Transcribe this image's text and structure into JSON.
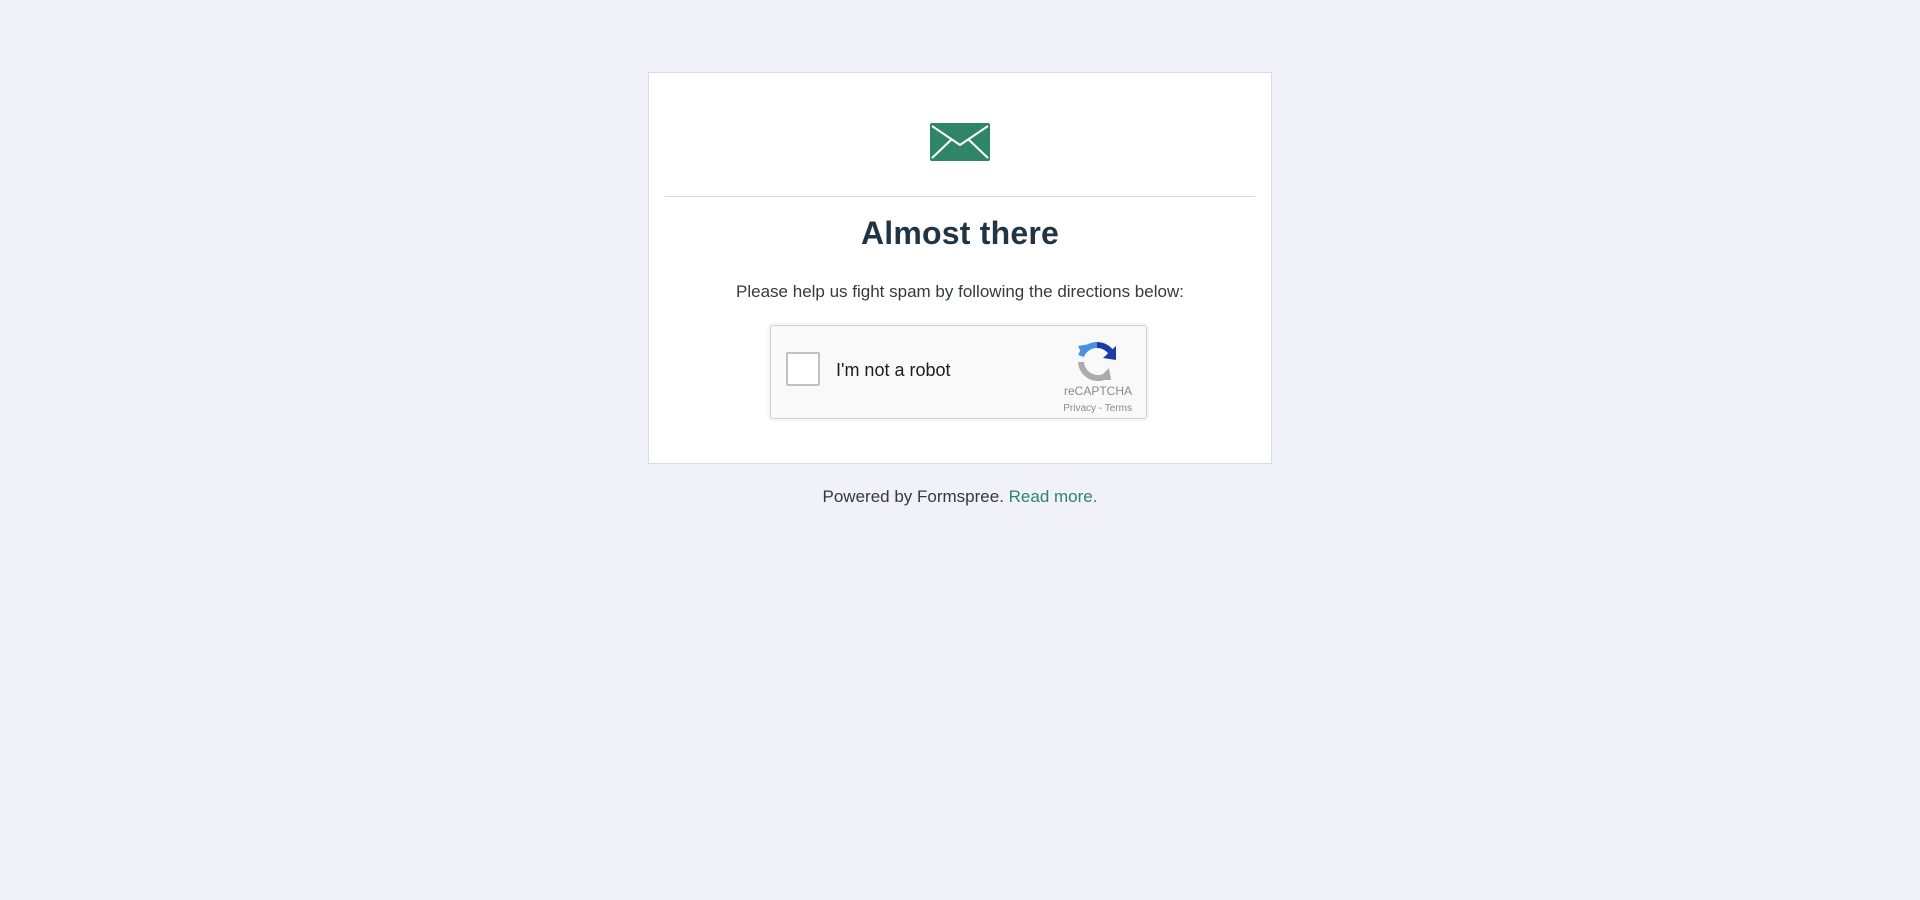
{
  "card": {
    "icon": "envelope-icon",
    "title": "Almost there",
    "subtitle": "Please help us fight spam by following the directions below:"
  },
  "recaptcha": {
    "checkbox_label": "I'm not a robot",
    "brand": "reCAPTCHA",
    "privacy_label": "Privacy",
    "separator": " - ",
    "terms_label": "Terms",
    "logo_icon": "recaptcha-logo-icon"
  },
  "footer": {
    "text": "Powered by Formspree.",
    "link_label": "Read more."
  },
  "colors": {
    "background": "#f0f1f9",
    "accent_green": "#2f8567",
    "title": "#1f3445"
  }
}
